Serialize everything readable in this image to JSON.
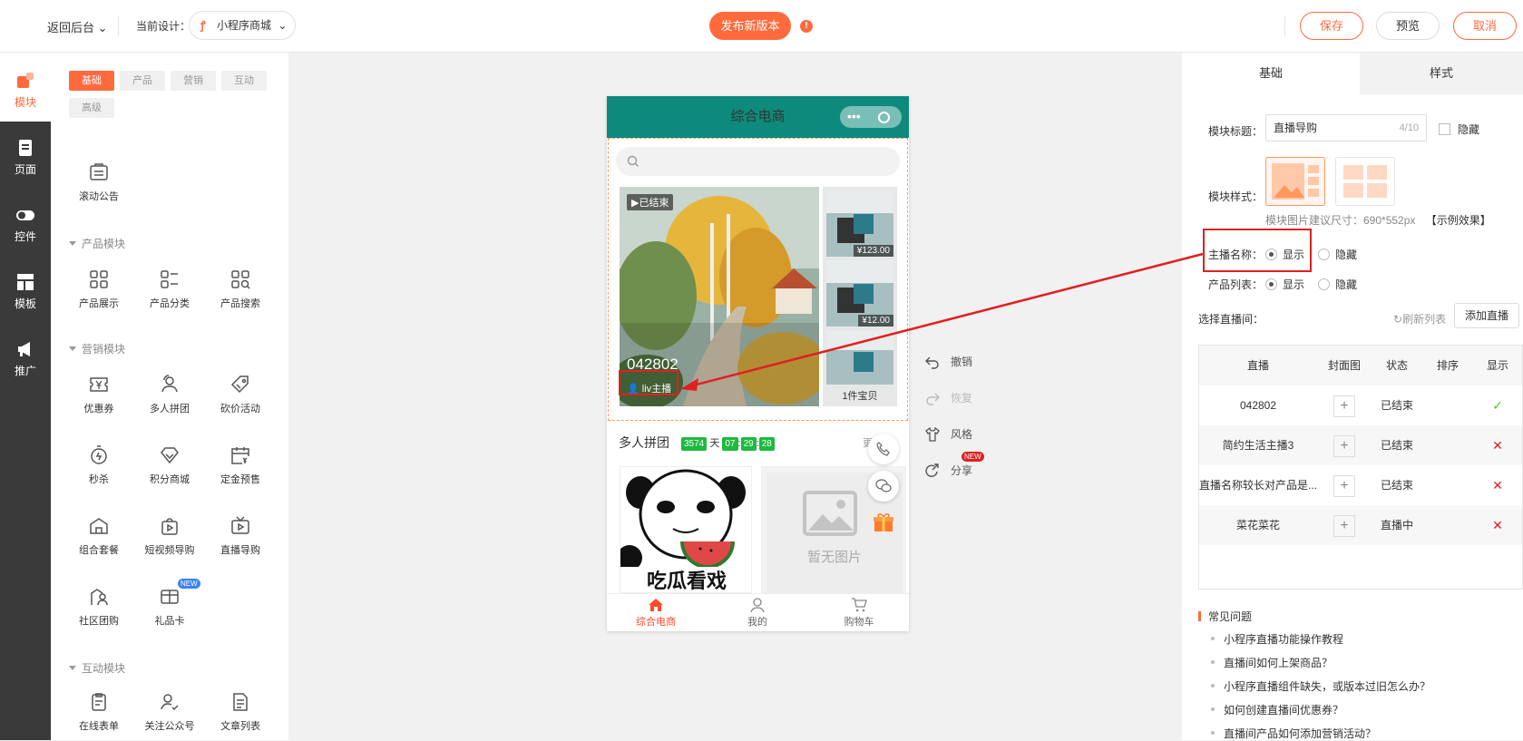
{
  "topbar": {
    "back": "返回后台",
    "current_design_label": "当前设计：",
    "design_name": "小程序商城",
    "publish": "发布新版本",
    "warn": "!",
    "save": "保存",
    "preview": "预览",
    "cancel": "取消"
  },
  "leftnav": [
    "模块",
    "页面",
    "控件",
    "模板",
    "推广"
  ],
  "palette": {
    "tabs": [
      "基础",
      "产品",
      "营销",
      "互动",
      "高级"
    ],
    "basic_items": [
      "滚动公告"
    ],
    "product_section": "产品模块",
    "product_items": [
      "产品展示",
      "产品分类",
      "产品搜索"
    ],
    "marketing_section": "营销模块",
    "marketing_items": [
      "优惠券",
      "多人拼团",
      "砍价活动",
      "秒杀",
      "积分商城",
      "定金预售",
      "组合套餐",
      "短视频导购",
      "直播导购",
      "社区团购",
      "礼品卡"
    ],
    "new_badge": "NEW",
    "interact_section": "互动模块",
    "interact_items": [
      "在线表单",
      "关注公众号",
      "文章列表"
    ]
  },
  "phone": {
    "title": "综合电商",
    "live_status": "已结束",
    "live_room": "042802",
    "anchor": "liv主播",
    "prices": [
      "¥123.00",
      "¥12.00"
    ],
    "product_count": "1件宝贝",
    "group_title": "多人拼团",
    "countdown": {
      "days": "3574",
      "day_unit": "天",
      "h": "07",
      "m": "29",
      "s": "28",
      "sep": ":"
    },
    "more": "更多",
    "meme_text": "吃瓜看戏",
    "no_image": "暂无图片",
    "bottom_nav": [
      "综合电商",
      "我的",
      "购物车"
    ]
  },
  "actions": {
    "undo": "撤销",
    "redo": "恢复",
    "style": "风格",
    "share": "分享",
    "new_badge": "NEW"
  },
  "props": {
    "tabs": [
      "基础",
      "样式"
    ],
    "module_title_label": "模块标题：",
    "module_title_value": "直播导购",
    "module_title_count": "4/10",
    "hide": "隐藏",
    "module_style_label": "模块样式：",
    "size_hint": "模块图片建议尺寸：690*552px",
    "example_link": "【示例效果】",
    "anchor_name_label": "主播名称：",
    "product_list_label": "产品列表：",
    "show": "显示",
    "select_live_label": "选择直播间：",
    "refresh": "刷新列表",
    "add_live": "添加直播",
    "table_headers": [
      "直播",
      "封面图",
      "状态",
      "排序",
      "显示"
    ],
    "rows": [
      {
        "name": "042802",
        "status": "已结束",
        "show": "✓",
        "show_color": "#52c41a"
      },
      {
        "name": "简约生活主播3",
        "status": "已结束",
        "show": "✕",
        "show_color": "#e02020"
      },
      {
        "name": "直播名称较长对产品是...",
        "status": "已结束",
        "show": "✕",
        "show_color": "#e02020"
      },
      {
        "name": "菜花菜花",
        "status": "直播中",
        "show": "✕",
        "show_color": "#e02020"
      }
    ],
    "faq_title": "常见问题",
    "faq": [
      "小程序直播功能操作教程",
      "直播间如何上架商品？",
      "小程序直播组件缺失，或版本过旧怎么办？",
      "如何创建直播间优惠券？",
      "直播间产品如何添加营销活动？"
    ]
  },
  "colors": {
    "accent": "#ff6a3d",
    "header_teal": "#0e8a7c",
    "callout_red": "#e02020",
    "countdown_green": "#1cba3e"
  }
}
